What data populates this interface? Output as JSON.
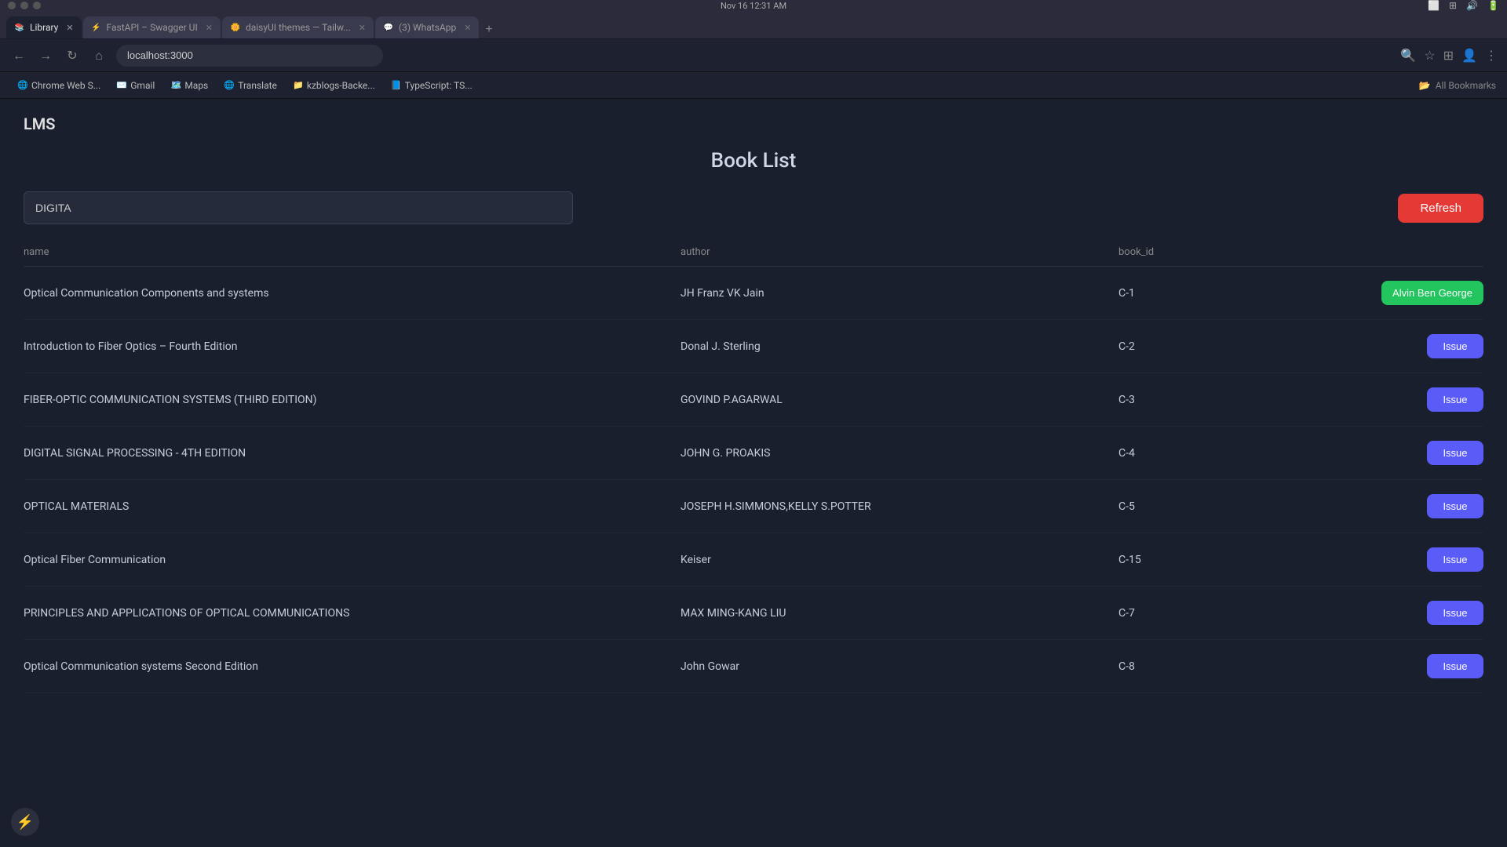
{
  "browser": {
    "time": "Nov 16  12:31 AM",
    "tabs": [
      {
        "id": "tab-library",
        "favicon": "📚",
        "label": "Library",
        "active": true
      },
      {
        "id": "tab-fastapi",
        "favicon": "⚡",
        "label": "FastAPI – Swagger UI",
        "active": false
      },
      {
        "id": "tab-daisyui",
        "favicon": "🌼",
        "label": "daisyUI themes — Tailw...",
        "active": false
      },
      {
        "id": "tab-whatsapp",
        "favicon": "💬",
        "label": "(3) WhatsApp",
        "active": false
      }
    ],
    "address": "localhost:3000"
  },
  "bookmarks": [
    {
      "favicon": "🌐",
      "label": "Chrome Web S..."
    },
    {
      "favicon": "✉️",
      "label": "Gmail"
    },
    {
      "favicon": "🗺️",
      "label": "Maps"
    },
    {
      "favicon": "🌐",
      "label": "Translate"
    },
    {
      "favicon": "📁",
      "label": "kzblogs-Backe..."
    },
    {
      "favicon": "📘",
      "label": "TypeScript: TS..."
    }
  ],
  "bookmarks_right": "All Bookmarks",
  "app": {
    "logo": "LMS",
    "page_title": "Book List",
    "search_value": "DIGITA",
    "search_placeholder": "",
    "refresh_label": "Refresh",
    "table_headers": {
      "name": "name",
      "author": "author",
      "book_id": "book_id"
    },
    "books": [
      {
        "name": "Optical Communication Components and systems",
        "author": "JH Franz VK Jain",
        "book_id": "C-1",
        "action": "issued",
        "action_label": "Alvin Ben George"
      },
      {
        "name": "Introduction to Fiber Optics – Fourth Edition",
        "author": "Donal J. Sterling",
        "book_id": "C-2",
        "action": "issue",
        "action_label": "Issue"
      },
      {
        "name": "FIBER-OPTIC COMMUNICATION SYSTEMS (THIRD EDITION)",
        "author": "GOVIND P.AGARWAL",
        "book_id": "C-3",
        "action": "issue",
        "action_label": "Issue"
      },
      {
        "name": "DIGITAL SIGNAL PROCESSING - 4TH EDITION",
        "author": "JOHN G. PROAKIS",
        "book_id": "C-4",
        "action": "issue",
        "action_label": "Issue"
      },
      {
        "name": "OPTICAL MATERIALS",
        "author": "JOSEPH H.SIMMONS,KELLY S.POTTER",
        "book_id": "C-5",
        "action": "issue",
        "action_label": "Issue"
      },
      {
        "name": "Optical Fiber Communication",
        "author": "Keiser",
        "book_id": "C-15",
        "action": "issue",
        "action_label": "Issue"
      },
      {
        "name": "PRINCIPLES AND APPLICATIONS OF OPTICAL COMMUNICATIONS",
        "author": "MAX MING-KANG LIU",
        "book_id": "C-7",
        "action": "issue",
        "action_label": "Issue"
      },
      {
        "name": "Optical Communication systems Second Edition",
        "author": "John Gowar",
        "book_id": "C-8",
        "action": "issue",
        "action_label": "Issue"
      }
    ]
  }
}
